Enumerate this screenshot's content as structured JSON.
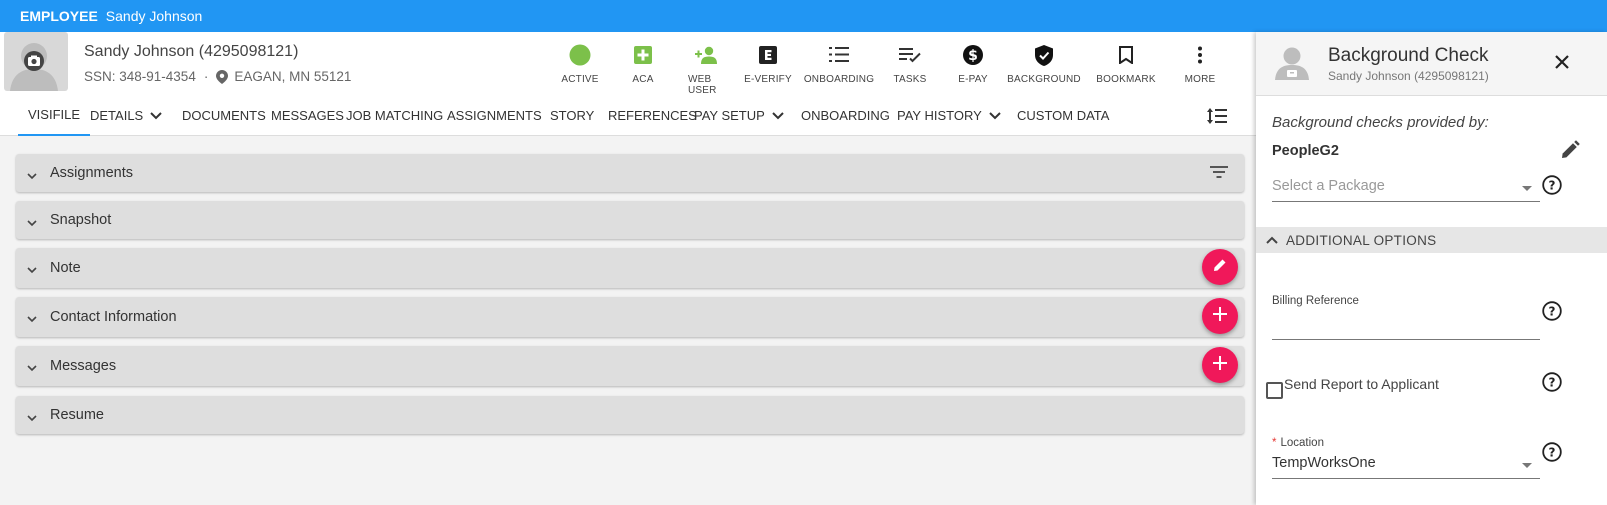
{
  "banner": {
    "type": "EMPLOYEE",
    "name": "Sandy Johnson"
  },
  "header": {
    "name_line": "Sandy Johnson (4295098121)",
    "ssn": "SSN: 348-91-4354",
    "separator": "·",
    "location": "EAGAN, MN 55121"
  },
  "status_items": [
    {
      "label": "ACTIVE",
      "icon": "green-dot-icon"
    },
    {
      "label": "ACA",
      "icon": "plus-box-icon"
    },
    {
      "label": "WEB USER",
      "icon": "person-add-icon"
    },
    {
      "label": "E-VERIFY",
      "icon": "e-box-icon"
    },
    {
      "label": "ONBOARDING",
      "icon": "numbered-list-icon"
    },
    {
      "label": "TASKS",
      "icon": "checklist-icon"
    },
    {
      "label": "E-PAY",
      "icon": "dollar-circle-icon"
    },
    {
      "label": "BACKGROUND",
      "icon": "shield-check-icon"
    },
    {
      "label": "BOOKMARK",
      "icon": "bookmark-icon"
    },
    {
      "label": "MORE",
      "icon": "more-vert-icon"
    }
  ],
  "tabs": [
    {
      "label": "VISIFILE",
      "active": true
    },
    {
      "label": "DETAILS",
      "dropdown": true
    },
    {
      "label": "DOCUMENTS"
    },
    {
      "label": "MESSAGES"
    },
    {
      "label": "JOB MATCHING"
    },
    {
      "label": "ASSIGNMENTS"
    },
    {
      "label": "STORY"
    },
    {
      "label": "REFERENCES"
    },
    {
      "label": "PAY SETUP",
      "dropdown": true
    },
    {
      "label": "ONBOARDING"
    },
    {
      "label": "PAY HISTORY",
      "dropdown": true
    },
    {
      "label": "CUSTOM DATA"
    }
  ],
  "panels": [
    {
      "title": "Assignments",
      "action": "filter"
    },
    {
      "title": "Snapshot"
    },
    {
      "title": "Note",
      "action": "edit"
    },
    {
      "title": "Contact Information",
      "action": "add"
    },
    {
      "title": "Messages",
      "action": "add"
    },
    {
      "title": "Resume"
    }
  ],
  "side_panel": {
    "title": "Background Check",
    "subtitle": "Sandy Johnson (4295098121)",
    "provided_by_label": "Background checks provided by:",
    "provider": "PeopleG2",
    "package_placeholder": "Select a Package",
    "additional_options": "ADDITIONAL OPTIONS",
    "billing_reference_label": "Billing Reference",
    "billing_reference_value": "",
    "send_report_label": "Send Report to Applicant",
    "send_report_checked": false,
    "location_label": "Location",
    "location_required_mark": "*",
    "location_value": "TempWorksOne"
  },
  "colors": {
    "banner": "#2196f3",
    "accent_green": "#7cc04a",
    "fab": "#f0185a",
    "tab_underline": "#2196f3"
  }
}
